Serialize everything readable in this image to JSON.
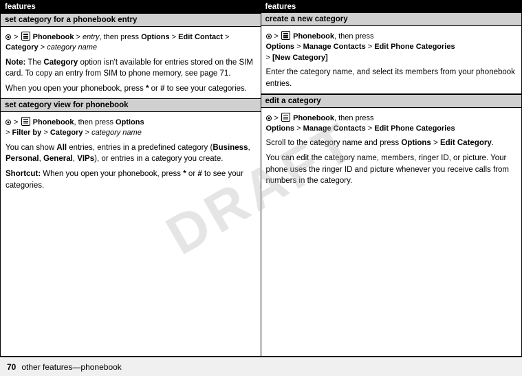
{
  "page": {
    "footer": {
      "page_number": "70",
      "page_label": "other features—phonebook"
    },
    "watermark": "DRAFT"
  },
  "left_column": {
    "header": "features",
    "sections": [
      {
        "id": "set-category-phonebook-entry",
        "subheader": "set category for a phonebook entry",
        "nav_line": "· > ☎ Phonebook > entry, then press Options > Edit Contact > Category > category name",
        "note_label": "Note:",
        "note_text": " The Category option isn't available for entries stored on the SIM card. To copy an entry from SIM to phone memory, see page 71.",
        "paragraph2": "When you open your phonebook, press * or # to see your categories."
      },
      {
        "id": "set-category-view-phonebook",
        "subheader": "set category view for phonebook",
        "nav_line": "· > ☎ Phonebook, then press Options > Filter by > Category > category name",
        "paragraph1": "You can show All entries, entries in a predefined category (Business, Personal, General, VIPs), or entries in a category you create.",
        "shortcut_label": "Shortcut:",
        "shortcut_text": " When you open your phonebook, press * or # to see your categories."
      }
    ]
  },
  "right_column": {
    "header": "features",
    "sections": [
      {
        "id": "create-new-category",
        "subheader": "create a new category",
        "nav_line": "· > ☎ Phonebook, then press Options > Manage Contacts > Edit Phone Categories > [New Category]",
        "paragraph1": "Enter the category name, and select its members from your phonebook entries."
      },
      {
        "id": "edit-a-category",
        "subheader": "edit a category",
        "nav_line": "· > ☎ Phonebook, then press Options > Manage Contacts > Edit Phone Categories",
        "paragraph1": "Scroll to the category name and press Options > Edit Category.",
        "paragraph2": "You can edit the category name, members, ringer ID, or picture. Your phone uses the ringer ID and picture whenever you receive calls from numbers in the category."
      }
    ]
  }
}
